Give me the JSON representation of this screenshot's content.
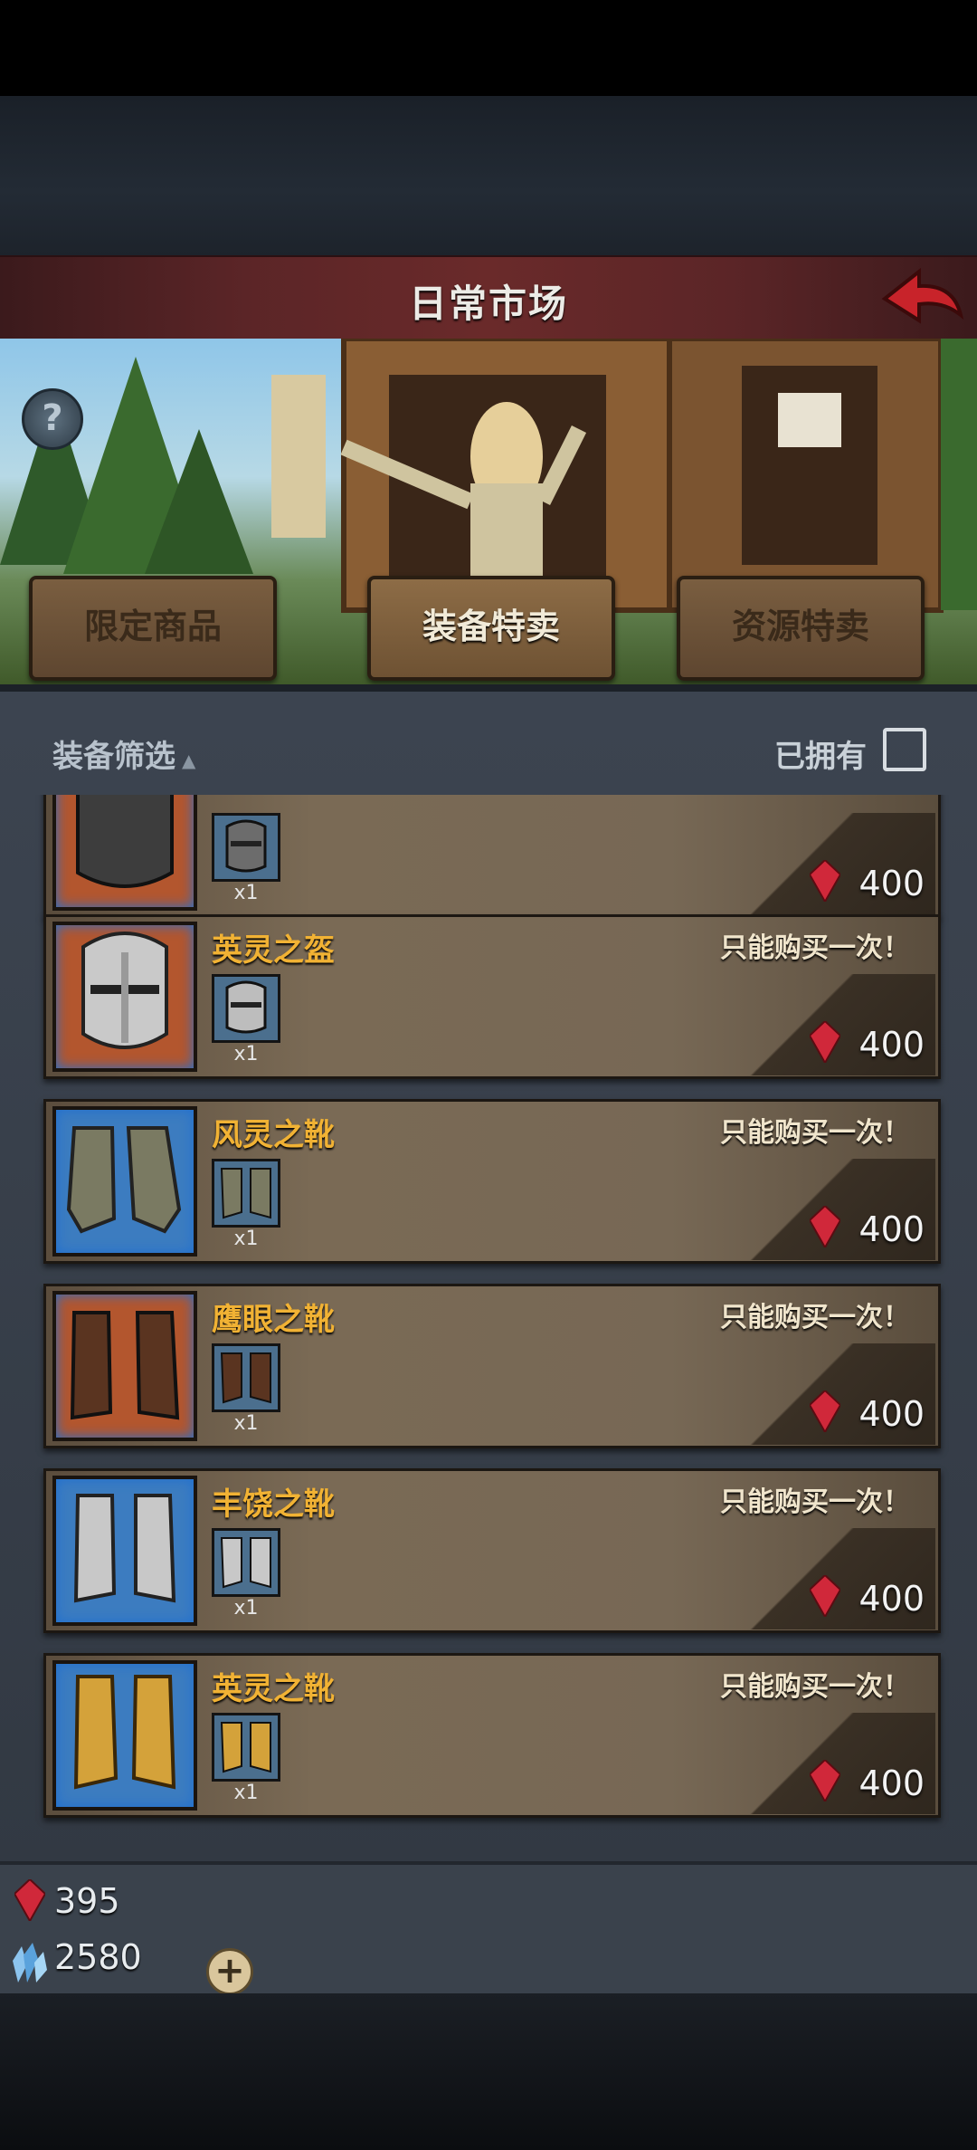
{
  "header": {
    "title": "日常市场"
  },
  "tabs": [
    {
      "label": "限定商品",
      "active": false
    },
    {
      "label": "装备特卖",
      "active": true
    },
    {
      "label": "资源特卖",
      "active": false
    }
  ],
  "filter": {
    "label": "装备筛选",
    "owned_label": "已拥有",
    "owned_checked": false
  },
  "items": [
    {
      "name": "",
      "icon": "helmet-icon",
      "qty": "x1",
      "once_label": "",
      "price": "400"
    },
    {
      "name": "英灵之盔",
      "icon": "helmet-icon",
      "qty": "x1",
      "once_label": "只能购买一次！",
      "price": "400"
    },
    {
      "name": "风灵之靴",
      "icon": "boots-icon",
      "qty": "x1",
      "once_label": "只能购买一次！",
      "price": "400"
    },
    {
      "name": "鹰眼之靴",
      "icon": "boots-icon",
      "qty": "x1",
      "once_label": "只能购买一次！",
      "price": "400"
    },
    {
      "name": "丰饶之靴",
      "icon": "boots-icon",
      "qty": "x1",
      "once_label": "只能购买一次！",
      "price": "400"
    },
    {
      "name": "英灵之靴",
      "icon": "boots-icon",
      "qty": "x1",
      "once_label": "只能购买一次！",
      "price": "400"
    }
  ],
  "currency": {
    "rubies": "395",
    "crystals": "2580"
  },
  "colors": {
    "accent_gold": "#f1b234",
    "title_bar": "#5b2527",
    "ruby": "#d0283a"
  }
}
